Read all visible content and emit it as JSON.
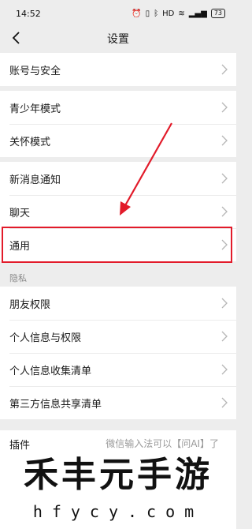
{
  "status_bar": {
    "time": "14:52",
    "icons": [
      "alarm-icon",
      "vibrate-icon",
      "bluetooth-icon",
      "hd-icon",
      "wifi-icon",
      "signal-icon"
    ],
    "hd_label": "HD",
    "battery": "73"
  },
  "header": {
    "title": "设置"
  },
  "groups": {
    "account": {
      "items": [
        "账号与安全"
      ]
    },
    "modes": {
      "items": [
        "青少年模式",
        "关怀模式"
      ]
    },
    "general": {
      "items": [
        "新消息通知",
        "聊天",
        "通用"
      ]
    },
    "privacy_label": "隐私",
    "privacy": {
      "items": [
        "朋友权限",
        "个人信息与权限",
        "个人信息收集清单",
        "第三方信息共享清单"
      ]
    }
  },
  "partial_row": {
    "label": "插件",
    "desc": "微信输入法可以【问AI】了"
  },
  "annotation": {
    "highlight_color": "#e21b2a"
  },
  "watermark": {
    "big": "禾丰元手游",
    "small": "hfycy.com"
  }
}
